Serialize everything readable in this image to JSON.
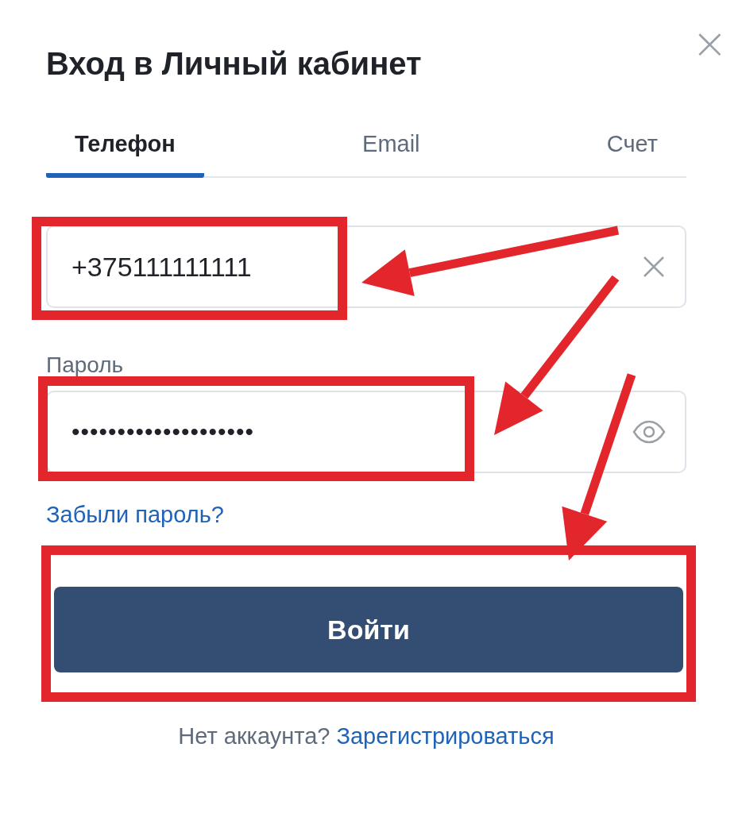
{
  "dialog": {
    "title": "Вход в Личный кабинет",
    "close": "×"
  },
  "tabs": [
    {
      "label": "Телефон",
      "selected": true
    },
    {
      "label": "Email",
      "selected": false
    },
    {
      "label": "Счет",
      "selected": false
    }
  ],
  "phone_field": {
    "value": "+375111111111",
    "highlighted": true
  },
  "password_field": {
    "label": "Пароль",
    "value": "••••••••••••••••••••",
    "highlighted": true
  },
  "forgot_link": "Забыли пароль?",
  "login_button": {
    "label": "Войти",
    "highlighted": true
  },
  "footer": {
    "text": "Нет аккаунта?",
    "link": "Зарегистрироваться"
  }
}
